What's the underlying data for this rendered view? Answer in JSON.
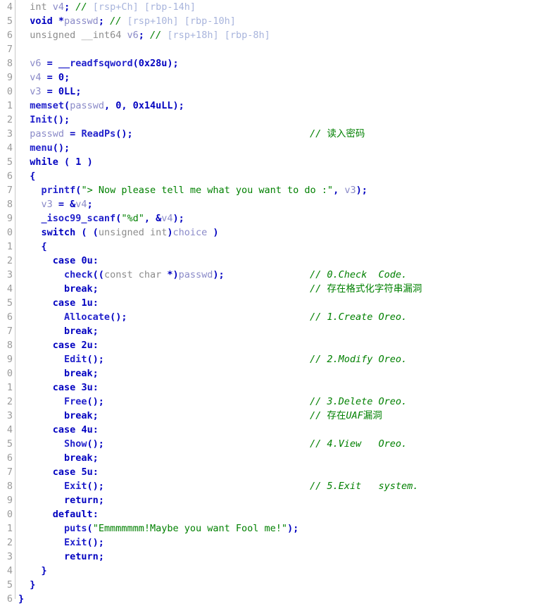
{
  "editor": {
    "name": "hex-rays-pseudocode-view",
    "background": "#ffffff",
    "gutter_color": "#9a9a9a",
    "first_line": 4,
    "last_line": 36,
    "colors": {
      "keyword": "#0000c0",
      "function": "#2222cc",
      "type": "#8c8c8c",
      "variable": "#8a8ac8",
      "string": "#008000",
      "comment": "#008000",
      "stack_offset": "#a8b4dc"
    }
  },
  "lines": [
    {
      "no": "4",
      "code": "  int v4; // [rsp+Ch] [rbp-14h]",
      "comment": ""
    },
    {
      "no": "5",
      "code": "  void *passwd; // [rsp+10h] [rbp-10h]",
      "comment": ""
    },
    {
      "no": "6",
      "code": "  unsigned __int64 v6; // [rsp+18h] [rbp-8h]",
      "comment": ""
    },
    {
      "no": "7",
      "code": "",
      "comment": ""
    },
    {
      "no": "8",
      "code": "  v6 = __readfsqword(0x28u);",
      "comment": ""
    },
    {
      "no": "9",
      "code": "  v4 = 0;",
      "comment": ""
    },
    {
      "no": "0",
      "code": "  v3 = 0LL;",
      "comment": ""
    },
    {
      "no": "1",
      "code": "  memset(passwd, 0, 0x14uLL);",
      "comment": ""
    },
    {
      "no": "2",
      "code": "  Init();",
      "comment": ""
    },
    {
      "no": "3",
      "code": "  passwd = ReadPs();",
      "comment": "// 读入密码"
    },
    {
      "no": "4",
      "code": "  menu();",
      "comment": ""
    },
    {
      "no": "5",
      "code": "  while ( 1 )",
      "comment": ""
    },
    {
      "no": "6",
      "code": "  {",
      "comment": ""
    },
    {
      "no": "7",
      "code": "    printf(\"> Now please tell me what you want to do :\", v3);",
      "comment": ""
    },
    {
      "no": "8",
      "code": "    v3 = &v4;",
      "comment": ""
    },
    {
      "no": "9",
      "code": "    _isoc99_scanf(\"%d\", &v4);",
      "comment": ""
    },
    {
      "no": "0",
      "code": "    switch ( (unsigned int)choice )",
      "comment": ""
    },
    {
      "no": "1",
      "code": "    {",
      "comment": ""
    },
    {
      "no": "2",
      "code": "      case 0u:",
      "comment": ""
    },
    {
      "no": "3",
      "code": "        check((const char *)passwd);",
      "comment": "// 0.Check  Code."
    },
    {
      "no": "4",
      "code": "        break;",
      "comment": "// 存在格式化字符串漏洞"
    },
    {
      "no": "5",
      "code": "      case 1u:",
      "comment": ""
    },
    {
      "no": "6",
      "code": "        Allocate();",
      "comment": "// 1.Create Oreo."
    },
    {
      "no": "7",
      "code": "        break;",
      "comment": ""
    },
    {
      "no": "8",
      "code": "      case 2u:",
      "comment": ""
    },
    {
      "no": "9",
      "code": "        Edit();",
      "comment": "// 2.Modify Oreo."
    },
    {
      "no": "0",
      "code": "        break;",
      "comment": ""
    },
    {
      "no": "1",
      "code": "      case 3u:",
      "comment": ""
    },
    {
      "no": "2",
      "code": "        Free();",
      "comment": "// 3.Delete Oreo."
    },
    {
      "no": "3",
      "code": "        break;",
      "comment": "// 存在UAF漏洞"
    },
    {
      "no": "4",
      "code": "      case 4u:",
      "comment": ""
    },
    {
      "no": "5",
      "code": "        Show();",
      "comment": "// 4.View   Oreo."
    },
    {
      "no": "6",
      "code": "        break;",
      "comment": ""
    },
    {
      "no": "7",
      "code": "      case 5u:",
      "comment": ""
    },
    {
      "no": "8",
      "code": "        Exit();",
      "comment": "// 5.Exit   system."
    },
    {
      "no": "9",
      "code": "        return;",
      "comment": ""
    },
    {
      "no": "0",
      "code": "      default:",
      "comment": ""
    },
    {
      "no": "1",
      "code": "        puts(\"Emmmmmmm!Maybe you want Fool me!\");",
      "comment": ""
    },
    {
      "no": "2",
      "code": "        Exit();",
      "comment": ""
    },
    {
      "no": "3",
      "code": "        return;",
      "comment": ""
    },
    {
      "no": "4",
      "code": "    }",
      "comment": ""
    },
    {
      "no": "5",
      "code": "  }",
      "comment": ""
    },
    {
      "no": "6",
      "code": "}",
      "comment": ""
    }
  ]
}
